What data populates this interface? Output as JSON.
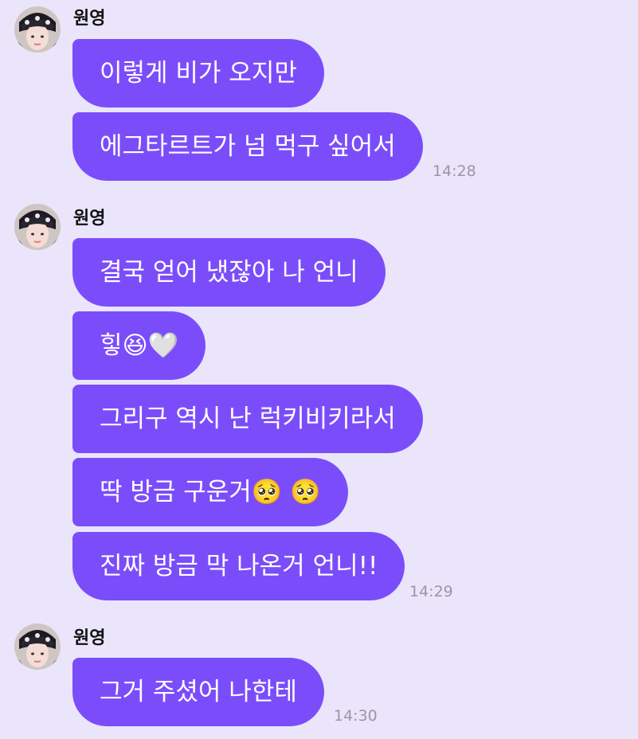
{
  "chat": {
    "bg_color": "#EAE5FB",
    "bubble_color": "#7B4DFA",
    "groups": [
      {
        "sender": "원영",
        "messages": [
          "이렇게 비가 오지만",
          "에그타르트가 넘 먹구 싶어서"
        ],
        "time": "14:28"
      },
      {
        "sender": "원영",
        "messages": [
          "결국 얻어 냈잖아 나 언니",
          "힣😆🤍",
          "그리구 역시 난 럭키비키라서",
          "딱 방금 구운거🥺 🥺",
          "진짜 방금 막 나온거 언니!!"
        ],
        "time": "14:29"
      },
      {
        "sender": "원영",
        "messages": [
          "그거 주셨어 나한테"
        ],
        "time": "14:30"
      }
    ]
  }
}
